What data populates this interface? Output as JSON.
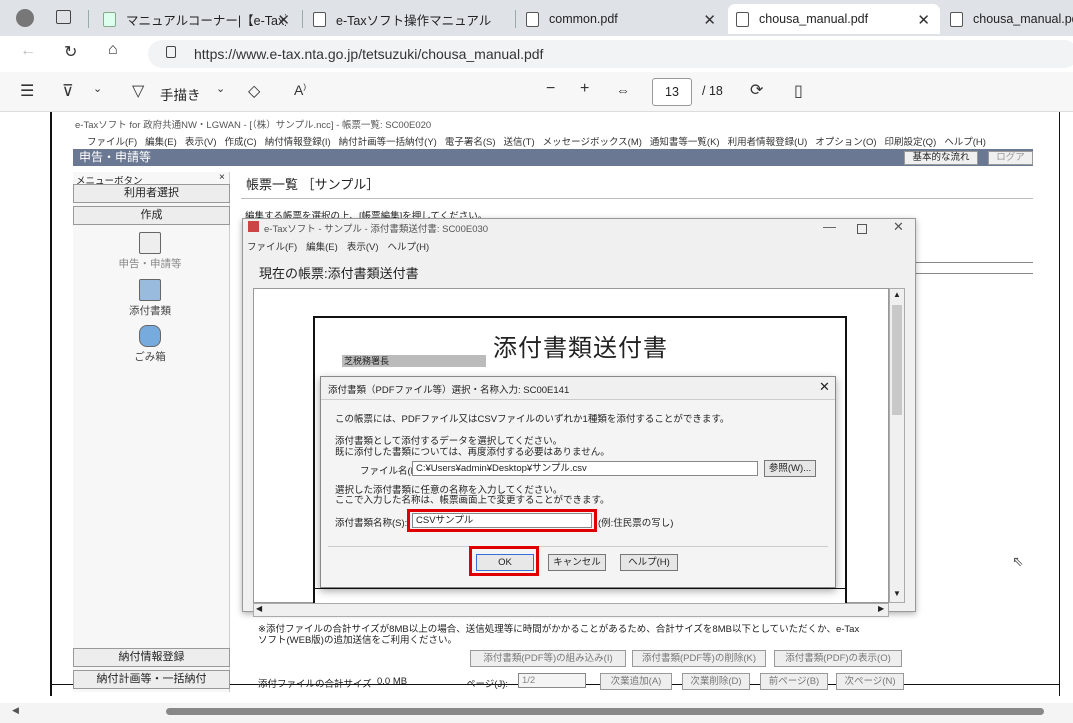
{
  "browser": {
    "tabs": [
      {
        "title": "マニュアルコーナー|【e-Tax】国税",
        "active": false
      },
      {
        "title": "e-Taxソフト操作マニュアル",
        "active": false
      },
      {
        "title": "common.pdf",
        "active": false
      },
      {
        "title": "chousa_manual.pdf",
        "active": true
      },
      {
        "title": "chousa_manual.pd",
        "active": false
      }
    ],
    "url": "https://www.e-tax.nta.go.jp/tetsuzuki/chousa_manual.pdf"
  },
  "pdf_toolbar": {
    "draw_label": "手描き",
    "page_current": "13",
    "page_total": "/ 18"
  },
  "app": {
    "title": "e-Taxソフト for 政府共通NW・LGWAN - [（株）サンプル.ncc] - 帳票一覧: SC00E020",
    "menu": [
      "ファイル(F)",
      "編集(E)",
      "表示(V)",
      "作成(C)",
      "納付情報登録(I)",
      "納付計画等一括納付(Y)",
      "電子署名(S)",
      "送信(T)",
      "メッセージボックス(M)",
      "通知書等一覧(K)",
      "利用者情報登録(U)",
      "オプション(O)",
      "印刷設定(Q)",
      "ヘルプ(H)"
    ],
    "section_title": "申告・申請等",
    "basic_flow": "基本的な流れ",
    "logout": "ログア",
    "sidebar": {
      "header": "メニューボタン",
      "header_close": "×",
      "user_select": "利用者選択",
      "create": "作成",
      "icon1": "申告・申請等",
      "icon2": "添付書類",
      "icon3": "ごみ箱",
      "pay_register": "納付情報登録",
      "pay_plan": "納付計画等・一括納付"
    },
    "list_header": "帳票一覧 ［サンプル］",
    "list_instruction": "編集する帳票を選択の上、[帳票編集]を押してください。"
  },
  "subwindow": {
    "title": "e-Taxソフト - サンプル - 添付書類送付書: SC00E030",
    "menu": [
      "ファイル(F)",
      "編集(E)",
      "表示(V)",
      "ヘルプ(H)"
    ],
    "current_form": "現在の帳票:添付書類送付書",
    "form_title": "添付書類送付書",
    "tax_office": "芝税務署長",
    "note": "※添付ファイルの合計サイズが8MB以上の場合、送信処理等に時間がかかることがあるため、合計サイズを8MB以下としていただくか、e-Tax ソフト(WEB版)の追加送信をご利用ください。",
    "note_line1": "※添付ファイルの合計サイズが8MB以上の場合、送信処理等に時間がかかることがあるため、合計サイズを8MB以下としていただくか、e-Tax",
    "note_line2": "ソフト(WEB版)の追加送信をご利用ください。",
    "btn_embed": "添付書類(PDF等)の組み込み(I)",
    "btn_delete": "添付書類(PDF等)の削除(K)",
    "btn_view": "添付書類(PDF)の表示(O)",
    "total_size_label": "添付ファイルの合計サイズ",
    "total_size": "0.0 MB",
    "page_label": "ページ(J):",
    "page_value": "1/2",
    "btn_add": "次業追加(A)",
    "btn_remove": "次業削除(D)",
    "btn_prev": "前ページ(B)",
    "btn_next": "次ページ(N)"
  },
  "dialog": {
    "title": "添付書類（PDFファイル等）選択・名称入力: SC00E141",
    "line1": "この帳票には、PDFファイル又はCSVファイルのいずれか1種類を添付することができます。",
    "line2": "添付書類として添付するデータを選択してください。",
    "line3": "既に添付した書類については、再度添付する必要はありません。",
    "file_label": "ファイル名(E):",
    "file_value": "C:¥Users¥admin¥Desktop¥サンプル.csv",
    "browse": "参照(W)...",
    "line4": "選択した添付書類に任意の名称を入力してください。",
    "line5": "ここで入力した名称は、帳票画面上で変更することができます。",
    "name_label": "添付書類名称(S):",
    "name_value": "CSVサンプル",
    "name_example": "(例:住民票の写し)",
    "ok": "OK",
    "cancel": "キャンセル",
    "help": "ヘルプ(H)"
  },
  "colors": {
    "highlight": "#e00000",
    "titlebar": "#6b7893"
  }
}
